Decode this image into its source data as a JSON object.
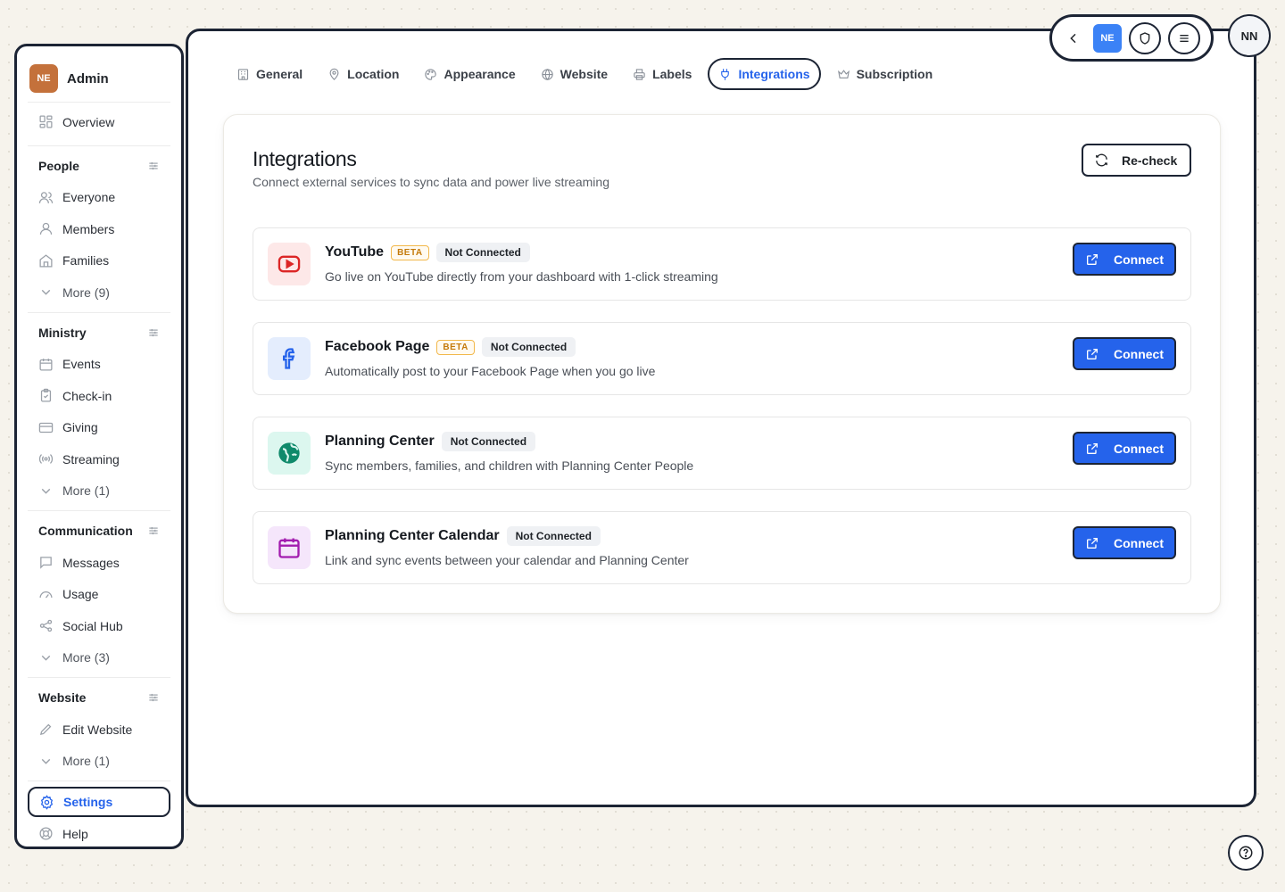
{
  "brand": {
    "badge": "NE",
    "name": "Admin"
  },
  "sidebar": {
    "overview": {
      "label": "Overview",
      "icon": "grid-icon"
    },
    "sections": [
      {
        "title": "People",
        "items": [
          {
            "label": "Everyone",
            "icon": "users-icon"
          },
          {
            "label": "Members",
            "icon": "user-icon"
          },
          {
            "label": "Families",
            "icon": "home-icon"
          }
        ],
        "more": "More (9)"
      },
      {
        "title": "Ministry",
        "items": [
          {
            "label": "Events",
            "icon": "calendar-icon"
          },
          {
            "label": "Check-in",
            "icon": "clipboard-check-icon"
          },
          {
            "label": "Giving",
            "icon": "credit-card-icon"
          },
          {
            "label": "Streaming",
            "icon": "broadcast-icon"
          }
        ],
        "more": "More (1)"
      },
      {
        "title": "Communication",
        "items": [
          {
            "label": "Messages",
            "icon": "message-icon"
          },
          {
            "label": "Usage",
            "icon": "gauge-icon"
          },
          {
            "label": "Social Hub",
            "icon": "share-icon"
          }
        ],
        "more": "More (3)"
      },
      {
        "title": "Website",
        "items": [
          {
            "label": "Edit Website",
            "icon": "pencil-icon"
          }
        ],
        "more": "More (1)"
      }
    ],
    "settings": {
      "label": "Settings",
      "icon": "gear-icon"
    },
    "help": {
      "label": "Help",
      "icon": "lifebuoy-icon"
    }
  },
  "tabs": [
    {
      "label": "General",
      "icon": "building-icon"
    },
    {
      "label": "Location",
      "icon": "map-pin-icon"
    },
    {
      "label": "Appearance",
      "icon": "palette-icon"
    },
    {
      "label": "Website",
      "icon": "globe-icon"
    },
    {
      "label": "Labels",
      "icon": "printer-icon"
    },
    {
      "label": "Integrations",
      "icon": "plug-icon",
      "active": true
    },
    {
      "label": "Subscription",
      "icon": "crown-icon"
    }
  ],
  "integrations": {
    "title": "Integrations",
    "subtitle": "Connect external services to sync data and power live streaming",
    "recheck_label": "Re-check",
    "items": [
      {
        "name": "YouTube",
        "beta": "BETA",
        "status": "Not Connected",
        "description": "Go live on YouTube directly from your dashboard with 1-click streaming",
        "button": "Connect",
        "icon": "youtube-icon",
        "color": "#dc2626",
        "bg": "#fde8e8"
      },
      {
        "name": "Facebook Page",
        "beta": "BETA",
        "status": "Not Connected",
        "description": "Automatically post to your Facebook Page when you go live",
        "button": "Connect",
        "icon": "facebook-icon",
        "color": "#2563eb",
        "bg": "#e4edfd"
      },
      {
        "name": "Planning Center",
        "status": "Not Connected",
        "description": "Sync members, families, and children with Planning Center People",
        "button": "Connect",
        "icon": "planning-center-icon",
        "color": "#0f8a6b",
        "bg": "#dcf7ef"
      },
      {
        "name": "Planning Center Calendar",
        "status": "Not Connected",
        "description": "Link and sync events between your calendar and Planning Center",
        "button": "Connect",
        "icon": "calendar-icon",
        "color": "#a21caf",
        "bg": "#f5e6fb"
      }
    ]
  },
  "topbar": {
    "workspace_badge": "NE",
    "avatar": "NN"
  },
  "colors": {
    "accent": "#2563eb",
    "border": "#1c2434",
    "brand": "#c4713b"
  }
}
